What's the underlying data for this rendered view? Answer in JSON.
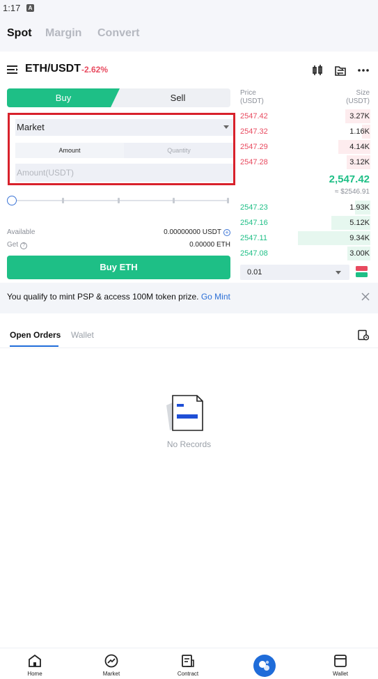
{
  "status_bar": {
    "time": "1:17",
    "notification_glyph": "A"
  },
  "top_tabs": [
    {
      "label": "Spot",
      "active": true
    },
    {
      "label": "Margin",
      "active": false
    },
    {
      "label": "Convert",
      "active": false
    }
  ],
  "pair": {
    "name": "ETH/USDT",
    "change": "-2.62%",
    "change_color": "#e84a5f"
  },
  "header_icons": [
    "candlestick-chart-icon",
    "transfer-icon",
    "more-icon"
  ],
  "trade": {
    "buy_label": "Buy",
    "sell_label": "Sell",
    "order_type": "Market",
    "amount_tab": "Amount",
    "quantity_tab": "Quantity",
    "amount_placeholder": "Amount(USDT)",
    "slider_percent": 0,
    "available_label": "Available",
    "available_value": "0.00000000 USDT",
    "get_label": "Get",
    "get_value": "0.00000 ETH",
    "buy_button": "Buy ETH"
  },
  "orderbook": {
    "price_header": "Price",
    "price_unit": "(USDT)",
    "size_header": "Size",
    "size_unit": "(USDT)",
    "asks": [
      {
        "price": "2547.42",
        "size": "3.27K",
        "depth": 0.35
      },
      {
        "price": "2547.32",
        "size": "1.16K",
        "depth": 0.12
      },
      {
        "price": "2547.29",
        "size": "4.14K",
        "depth": 0.44
      },
      {
        "price": "2547.28",
        "size": "3.12K",
        "depth": 0.33
      }
    ],
    "last_price": "2,547.42",
    "fiat_price": "≈ $2546.91",
    "bids": [
      {
        "price": "2547.23",
        "size": "1.93K",
        "depth": 0.21
      },
      {
        "price": "2547.16",
        "size": "5.12K",
        "depth": 0.54
      },
      {
        "price": "2547.11",
        "size": "9.34K",
        "depth": 1.0
      },
      {
        "price": "2547.08",
        "size": "3.00K",
        "depth": 0.32
      }
    ],
    "depth_value": "0.01"
  },
  "banner": {
    "text": "You qualify to mint PSP & access 100M token prize.",
    "link": "Go Mint"
  },
  "orders": {
    "tabs": [
      "Open Orders",
      "Wallet"
    ],
    "empty_text": "No Records"
  },
  "bottom_nav": [
    "Home",
    "Market",
    "Contract",
    "",
    "Wallet"
  ],
  "colors": {
    "green": "#1ebf86",
    "red": "#e84a5f",
    "blue": "#1f6cd9"
  }
}
